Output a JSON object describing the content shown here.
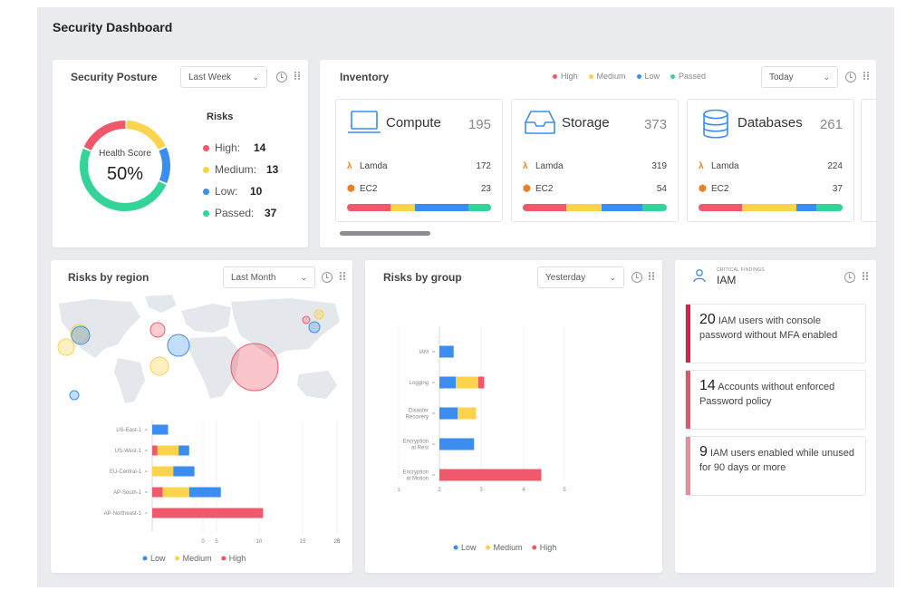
{
  "page_title": "Security Dashboard",
  "posture": {
    "title": "Security Posture",
    "period": "Last Week",
    "health_label": "Health Score",
    "health_value": "50%",
    "risks_title": "Risks",
    "risks": [
      {
        "label": "High:",
        "value": "14",
        "color": "#f0596b"
      },
      {
        "label": "Medium:",
        "value": "13",
        "color": "#fcd34d"
      },
      {
        "label": "Low:",
        "value": "10",
        "color": "#3b8ef0"
      },
      {
        "label": "Passed:",
        "value": "37",
        "color": "#34d399"
      }
    ]
  },
  "inventory": {
    "title": "Inventory",
    "period": "Today",
    "legend": [
      {
        "label": "High",
        "color": "#f0596b"
      },
      {
        "label": "Medium",
        "color": "#fcd34d"
      },
      {
        "label": "Low",
        "color": "#3b8ef0"
      },
      {
        "label": "Passed",
        "color": "#34d399"
      }
    ],
    "cards": [
      {
        "name": "Compute",
        "count": "195",
        "icon": "laptop-icon",
        "rows": [
          {
            "label": "Lamda",
            "value": "172"
          },
          {
            "label": "EC2",
            "value": "23"
          }
        ],
        "bar": [
          0.3,
          0.17,
          0.37,
          0.16
        ]
      },
      {
        "name": "Storage",
        "count": "373",
        "icon": "inbox-tray-icon",
        "rows": [
          {
            "label": "Lamda",
            "value": "319"
          },
          {
            "label": "EC2",
            "value": "54"
          }
        ],
        "bar": [
          0.3,
          0.25,
          0.28,
          0.17
        ]
      },
      {
        "name": "Databases",
        "count": "261",
        "icon": "database-icon",
        "rows": [
          {
            "label": "Lamda",
            "value": "224"
          },
          {
            "label": "EC2",
            "value": "37"
          }
        ],
        "bar": [
          0.3,
          0.38,
          0.14,
          0.18
        ]
      }
    ]
  },
  "region": {
    "title": "Risks by region",
    "period": "Last Month",
    "legend": [
      "Low",
      "Medium",
      "High"
    ]
  },
  "group": {
    "title": "Risks by group",
    "period": "Yesterday",
    "legend": [
      "Low",
      "Medium",
      "High"
    ]
  },
  "iam": {
    "subtitle": "CRITICAL FINDINGS",
    "title": "IAM",
    "items": [
      {
        "num": "20",
        "text": "IAM users with console password without MFA enabled",
        "color": "#e11d48"
      },
      {
        "num": "14",
        "text": "Accounts without enforced Password policy",
        "color": "#e0566c"
      },
      {
        "num": "9",
        "text": "IAM users enabled while unused for 90 days or more",
        "color": "#f08a9a"
      }
    ]
  },
  "colors": {
    "high": "#f0596b",
    "medium": "#fcd34d",
    "low": "#3b8ef0",
    "passed": "#34d399"
  },
  "chart_data": [
    {
      "type": "bar",
      "orientation": "horizontal",
      "stacked": true,
      "categories": [
        "US-East-1",
        "US-West-1",
        "EU-Central-1",
        "AP-South-1",
        "AP-Northeast-1"
      ],
      "series": [
        {
          "name": "High",
          "values": [
            0,
            1,
            0,
            2,
            21
          ]
        },
        {
          "name": "Medium",
          "values": [
            0,
            4,
            4,
            5,
            0
          ]
        },
        {
          "name": "Low",
          "values": [
            3,
            2,
            4,
            6,
            0
          ]
        }
      ],
      "xticks": [
        "0",
        "5",
        "10",
        "15",
        "20",
        "25"
      ],
      "xlim": [
        0,
        35
      ],
      "legend": "bottom"
    },
    {
      "type": "bar",
      "orientation": "horizontal",
      "stacked": true,
      "categories": [
        "IAM",
        "Logging",
        "Disaster Recovery",
        "Encryption at Rest",
        "Encryption at Motion"
      ],
      "series": [
        {
          "name": "Low",
          "values": [
            0.35,
            0.4,
            0.45,
            0.85,
            0
          ]
        },
        {
          "name": "Medium",
          "values": [
            0,
            0.55,
            0.45,
            0,
            0
          ]
        },
        {
          "name": "High",
          "values": [
            0,
            0.15,
            0,
            0,
            2.5
          ]
        }
      ],
      "xticks": [
        "1",
        "2",
        "3",
        "4",
        "5"
      ],
      "xlim": [
        0,
        5
      ],
      "legend": "bottom"
    }
  ]
}
